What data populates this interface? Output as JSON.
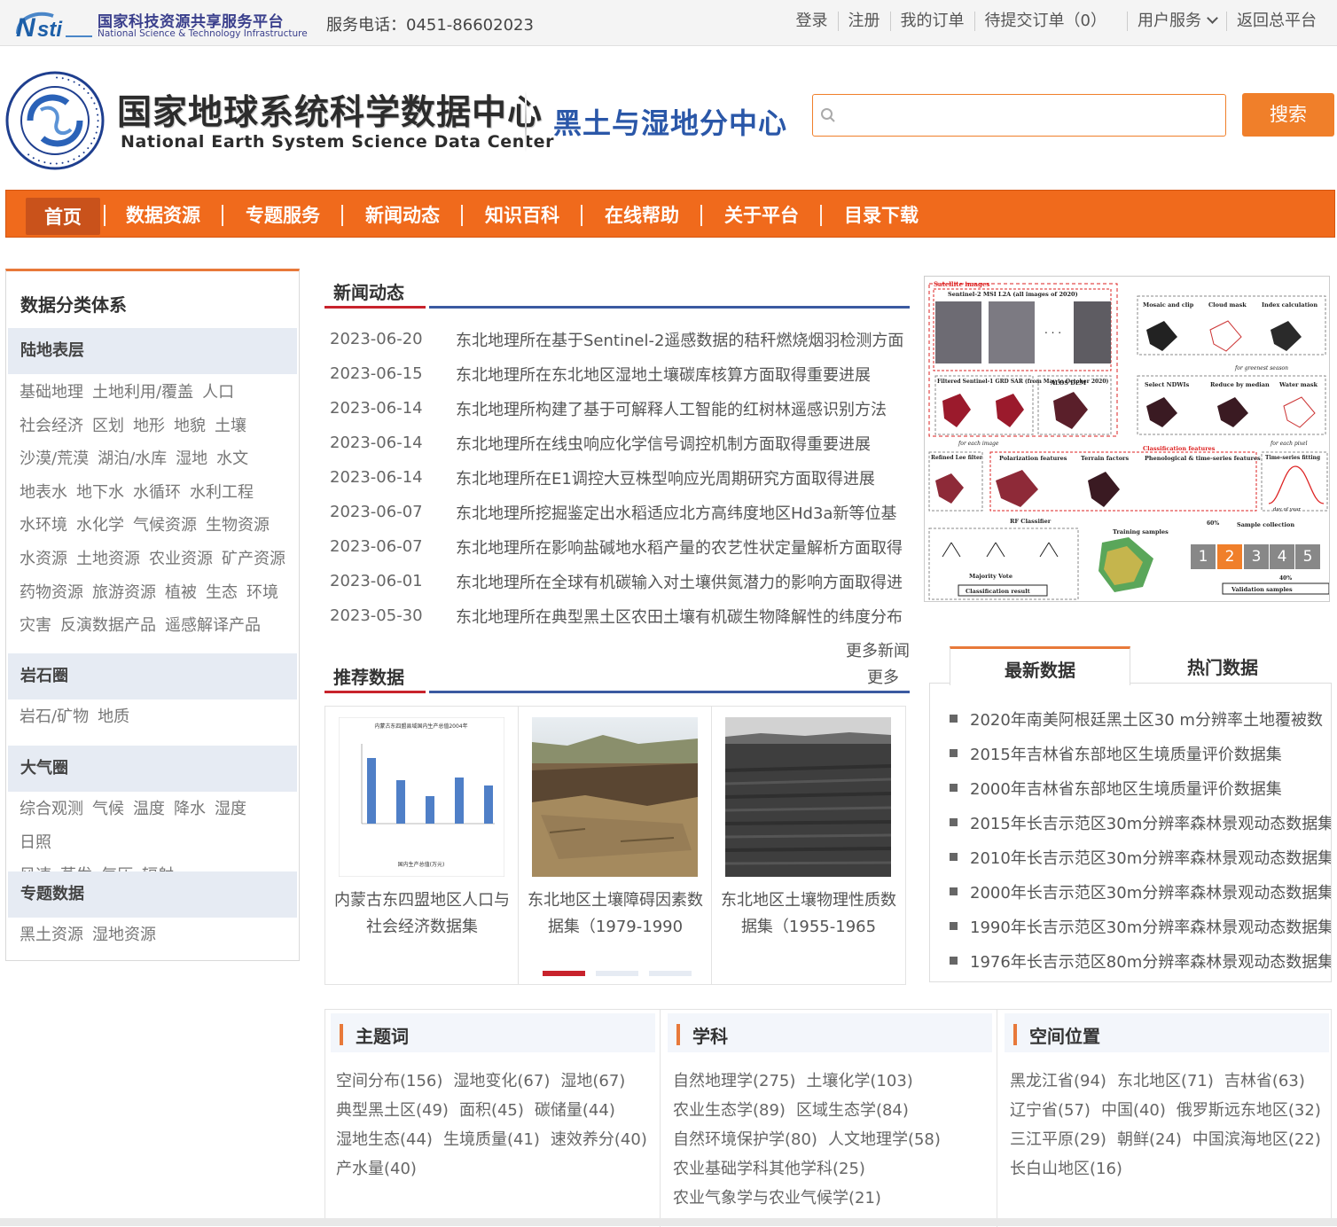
{
  "topbar": {
    "platform_cn": "国家科技资源共享服务平台",
    "platform_en": "National Science & Technology Infrastructure",
    "hotline": "服务电话：0451-86602023",
    "links": [
      "登录",
      "注册",
      "我的订单",
      "待提交订单（0）",
      "用户服务",
      "返回总平台"
    ]
  },
  "header": {
    "center_cn": "国家地球系统科学数据中心",
    "center_en": "National Earth System Science Data Center",
    "subcenter": "黑土与湿地分中心",
    "search_placeholder": "",
    "search_button": "搜索"
  },
  "nav": [
    "首页",
    "数据资源",
    "专题服务",
    "新闻动态",
    "知识百科",
    "在线帮助",
    "关于平台",
    "目录下载"
  ],
  "sidebar": {
    "title": "数据分类体系",
    "groups": [
      {
        "head": "陆地表层",
        "lines": [
          [
            "基础地理",
            "土地利用/覆盖",
            "人口"
          ],
          [
            "社会经济",
            "区划",
            "地形",
            "地貌",
            "土壤"
          ],
          [
            "沙漠/荒漠",
            "湖泊/水库",
            "湿地",
            "水文"
          ],
          [
            "地表水",
            "地下水",
            "水循环",
            "水利工程"
          ],
          [
            "水环境",
            "水化学",
            "气候资源",
            "生物资源"
          ],
          [
            "水资源",
            "土地资源",
            "农业资源",
            "矿产资源"
          ],
          [
            "药物资源",
            "旅游资源",
            "植被",
            "生态",
            "环境"
          ],
          [
            "灾害",
            "反演数据产品",
            "遥感解译产品"
          ]
        ]
      },
      {
        "head": "岩石圈",
        "lines": [
          [
            "岩石/矿物",
            "地质"
          ]
        ]
      },
      {
        "head": "大气圈",
        "lines": [
          [
            "综合观测",
            "气候",
            "温度",
            "降水",
            "湿度",
            "日照"
          ],
          [
            "风速",
            "蒸发",
            "气压",
            "辐射"
          ]
        ]
      },
      {
        "head": "专题数据",
        "lines": [
          [
            "黑土资源",
            "湿地资源"
          ]
        ]
      }
    ]
  },
  "news": {
    "title": "新闻动态",
    "more": "更多新闻",
    "items": [
      {
        "date": "2023-06-20",
        "text": "东北地理所在基于Sentinel-2遥感数据的秸秆燃烧烟羽检测方面"
      },
      {
        "date": "2023-06-15",
        "text": "东北地理所在东北地区湿地土壤碳库核算方面取得重要进展"
      },
      {
        "date": "2023-06-14",
        "text": "东北地理所构建了基于可解释人工智能的红树林遥感识别方法"
      },
      {
        "date": "2023-06-14",
        "text": "东北地理所在线虫响应化学信号调控机制方面取得重要进展"
      },
      {
        "date": "2023-06-14",
        "text": "东北地理所在E1调控大豆株型响应光周期研究方面取得进展"
      },
      {
        "date": "2023-06-07",
        "text": "东北地理所挖掘鉴定出水稻适应北方高纬度地区Hd3a新等位基"
      },
      {
        "date": "2023-06-07",
        "text": "东北地理所在影响盐碱地水稻产量的农艺性状定量解析方面取得"
      },
      {
        "date": "2023-06-01",
        "text": "东北地理所在全球有机碳输入对土壤供氮潜力的影响方面取得进"
      },
      {
        "date": "2023-05-30",
        "text": "东北地理所在典型黑土区农田土壤有机碳生物降解性的纬度分布"
      }
    ]
  },
  "recommended": {
    "title": "推荐数据",
    "more": "更多",
    "cards": [
      {
        "caption": "内蒙古东四盟地区人口与社会经济数据集",
        "chart_title": "内蒙古东四盟县域国内生产总值2004年",
        "chart_xlabel": "国内生产总值(万元)"
      },
      {
        "caption": "东北地区土壤障碍因素数据集（1979-1990"
      },
      {
        "caption": "东北地区土壤物理性质数据集（1955-1965"
      }
    ]
  },
  "carousel": {
    "pages": [
      "1",
      "2",
      "3",
      "4",
      "5"
    ],
    "active_page": "2",
    "diagram_labels": {
      "satellite": "Satellite images",
      "s2": "Sentinel-2 MSI L2A   (all images of 2020)",
      "mosaic": "Mosaic and clip",
      "cloud": "Cloud mask",
      "index": "Index calculation",
      "greenest": "for greenest season",
      "s1": "Filtered Sentinel-1 GRD SAR (from May to October 2020)",
      "alos": "ALOS DEM",
      "select": "Select NDWIs",
      "reduce": "Reduce by median",
      "water": "Water mask",
      "each_image": "for each image",
      "each_pixel": "for each pixel",
      "classfeat": "Classification features",
      "refined": "Refined Lee filter",
      "polar": "Polarization features",
      "terrain": "Terrain factors",
      "pheno": "Phenological & time-series features",
      "timeseries": "Time-series fitting",
      "rf": "RF Classifier",
      "training": "Training samples",
      "sample": "Sample collection",
      "majority": "Majority Vote",
      "result": "Classification result",
      "validation": "Validation samples",
      "pct60": "60%",
      "pct40": "40%",
      "doy": "day of year"
    }
  },
  "data_tabs": {
    "tabs": [
      "最新数据",
      "热门数据"
    ],
    "items": [
      "2020年南美阿根廷黑土区30 m分辨率土地覆被数",
      "2015年吉林省东部地区生境质量评价数据集",
      "2000年吉林省东部地区生境质量评价数据集",
      "2015年长吉示范区30m分辨率森林景观动态数据集",
      "2010年长吉示范区30m分辨率森林景观动态数据集",
      "2000年长吉示范区30m分辨率森林景观动态数据集",
      "1990年长吉示范区30m分辨率森林景观动态数据集",
      "1976年长吉示范区80m分辨率森林景观动态数据集"
    ]
  },
  "facets": [
    {
      "title": "主题词",
      "items": [
        "空间分布(156)",
        "湿地变化(67)",
        "湿地(67)",
        "典型黑土区(49)",
        "面积(45)",
        "碳储量(44)",
        "湿地生态(44)",
        "生境质量(41)",
        "速效养分(40)",
        "产水量(40)"
      ]
    },
    {
      "title": "学科",
      "items": [
        "自然地理学(275)",
        "土壤化学(103)",
        "农业生态学(89)",
        "区域生态学(84)",
        "自然环境保护学(80)",
        "人文地理学(58)",
        "农业基础学科其他学科(25)",
        "农业气象学与农业气候学(21)"
      ]
    },
    {
      "title": "空间位置",
      "items": [
        "黑龙江省(94)",
        "东北地区(71)",
        "吉林省(63)",
        "辽宁省(57)",
        "中国(40)",
        "俄罗斯远东地区(32)",
        "三江平原(29)",
        "朝鲜(24)",
        "中国滨海地区(22)",
        "长白山地区(16)"
      ]
    }
  ],
  "colors": {
    "accent": "#f07f2a",
    "nav": "#f06a1c",
    "nav_active": "#c9521b",
    "title_red": "#c8232c",
    "title_blue": "#3b5aa1",
    "subcenter_blue": "#2a57a8"
  }
}
